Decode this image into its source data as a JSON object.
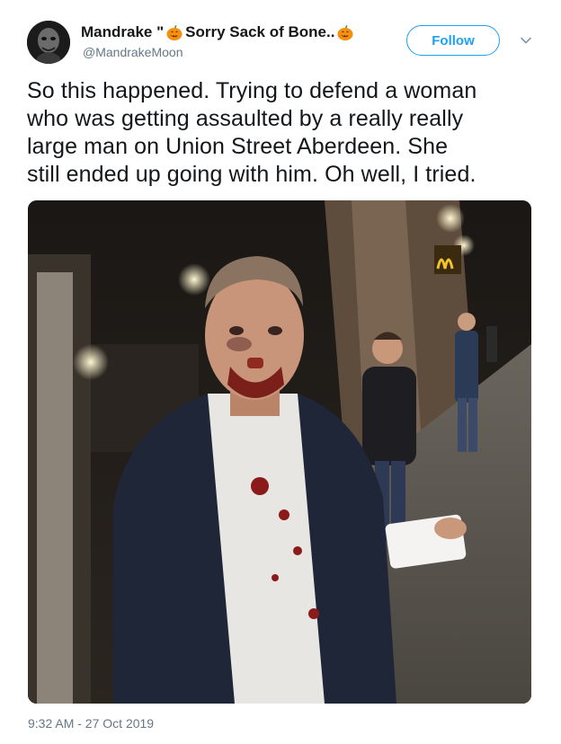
{
  "author": {
    "display_name_parts": [
      "Mandrake \"",
      "Sorry Sack of Bone..",
      ""
    ],
    "handle": "@MandrakeMoon"
  },
  "follow_button": {
    "label": "Follow"
  },
  "tweet": {
    "lines": [
      "So this happened. Trying to defend a woman",
      "who was getting assaulted by a really really",
      "large man on Union Street Aberdeen. She",
      "still ended up going with him. Oh well, I tried."
    ],
    "timestamp": "9:32 AM - 27 Oct 2019"
  },
  "colors": {
    "accent": "#1da1f2",
    "secondary_text": "#657786",
    "primary_text": "#14171a"
  },
  "icons": {
    "emoji": "pumpkin-emoji-icon",
    "menu": "chevron-down-icon"
  }
}
